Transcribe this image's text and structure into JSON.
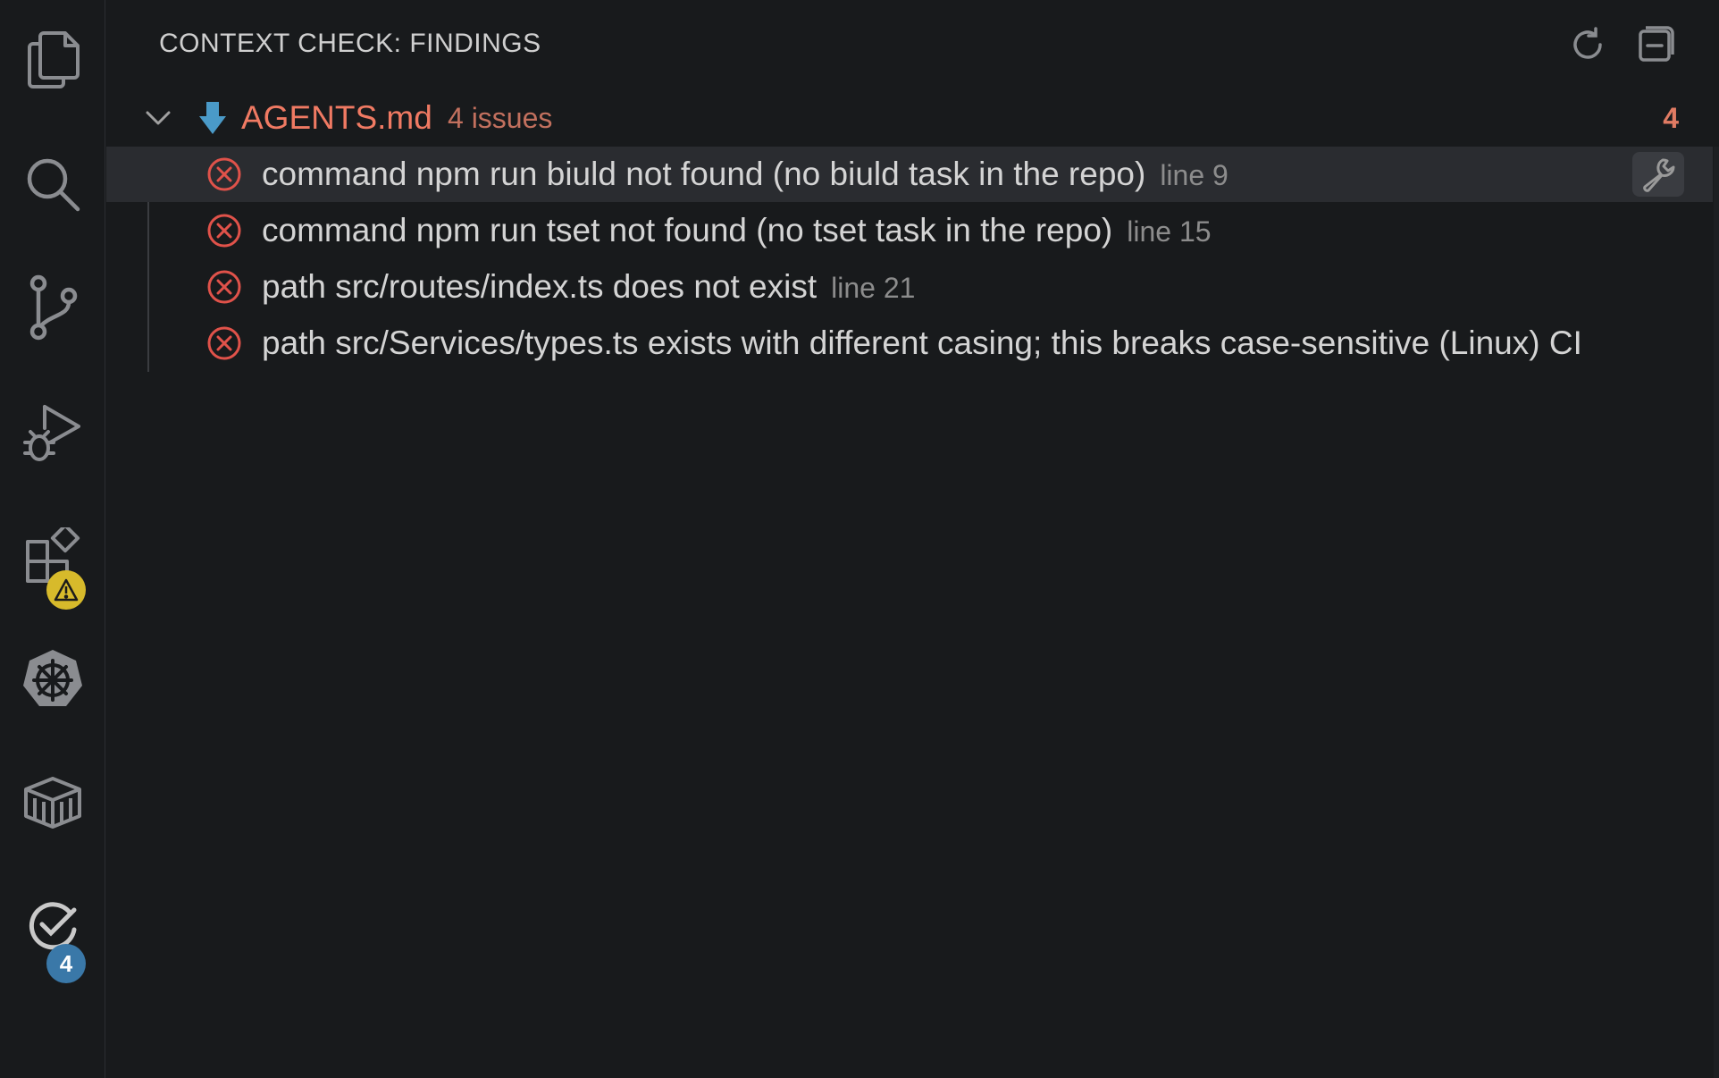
{
  "activity_bar": {
    "items": [
      {
        "name": "explorer",
        "icon": "files-icon"
      },
      {
        "name": "search",
        "icon": "search-icon"
      },
      {
        "name": "source-control",
        "icon": "source-control-icon"
      },
      {
        "name": "run-and-debug",
        "icon": "run-debug-icon"
      },
      {
        "name": "extensions",
        "icon": "extensions-icon",
        "badge": "warning"
      },
      {
        "name": "kubernetes",
        "icon": "kubernetes-icon"
      },
      {
        "name": "containers",
        "icon": "container-icon"
      },
      {
        "name": "context-check",
        "icon": "check-icon",
        "badge": "4"
      }
    ],
    "context_check_badge": "4"
  },
  "panel": {
    "title": "CONTEXT CHECK: FINDINGS",
    "actions": [
      {
        "name": "refresh",
        "icon": "refresh-icon"
      },
      {
        "name": "collapse-all",
        "icon": "collapse-all-icon"
      }
    ]
  },
  "findings": {
    "file": {
      "name": "AGENTS.md",
      "summary": "4 issues",
      "count": "4"
    },
    "issues": [
      {
        "text": "command npm run biuld not found (no biuld task in the repo)",
        "line": "line 9",
        "selected": true
      },
      {
        "text": "command npm run tset not found (no tset task in the repo)",
        "line": "line 15",
        "selected": false
      },
      {
        "text": "path src/routes/index.ts does not exist",
        "line": "line 21",
        "selected": false
      },
      {
        "text": "path src/Services/types.ts exists with different casing; this breaks case-sensitive (Linux) CI",
        "line": "",
        "selected": false
      }
    ]
  },
  "colors": {
    "background": "#181a1c",
    "error": "#e0524a",
    "file_name": "#f07a63",
    "warning_badge": "#d7ba2b",
    "count_badge": "#3a78a8"
  }
}
